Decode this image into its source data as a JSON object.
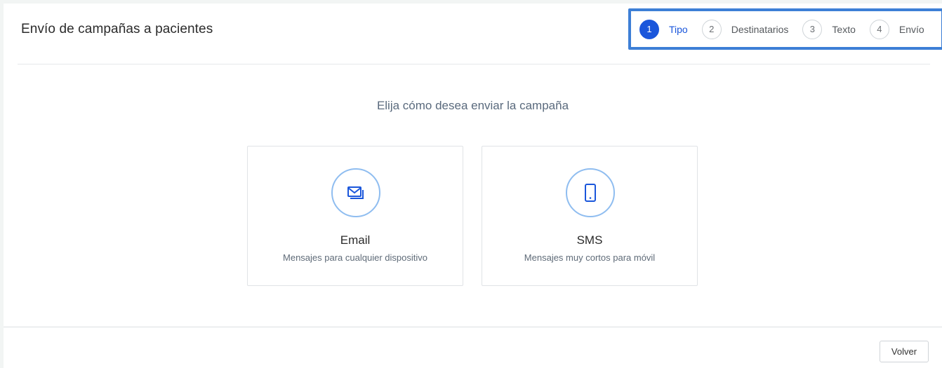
{
  "header": {
    "title": "Envío de campañas a pacientes"
  },
  "stepper": {
    "steps": [
      {
        "number": "1",
        "label": "Tipo",
        "active": true
      },
      {
        "number": "2",
        "label": "Destinatarios",
        "active": false
      },
      {
        "number": "3",
        "label": "Texto",
        "active": false
      },
      {
        "number": "4",
        "label": "Envío",
        "active": false
      }
    ]
  },
  "main": {
    "prompt": "Elija cómo desea enviar la campaña",
    "options": [
      {
        "title": "Email",
        "description": "Mensajes para cualquier dispositivo",
        "icon": "email-icon"
      },
      {
        "title": "SMS",
        "description": "Mensajes muy cortos para móvil",
        "icon": "mobile-phone-icon"
      }
    ]
  },
  "footer": {
    "back_label": "Volver"
  },
  "colors": {
    "accent": "#1a56db",
    "stepper_highlight_border": "#3d7fd6",
    "icon_ring": "#8fbdf0"
  }
}
